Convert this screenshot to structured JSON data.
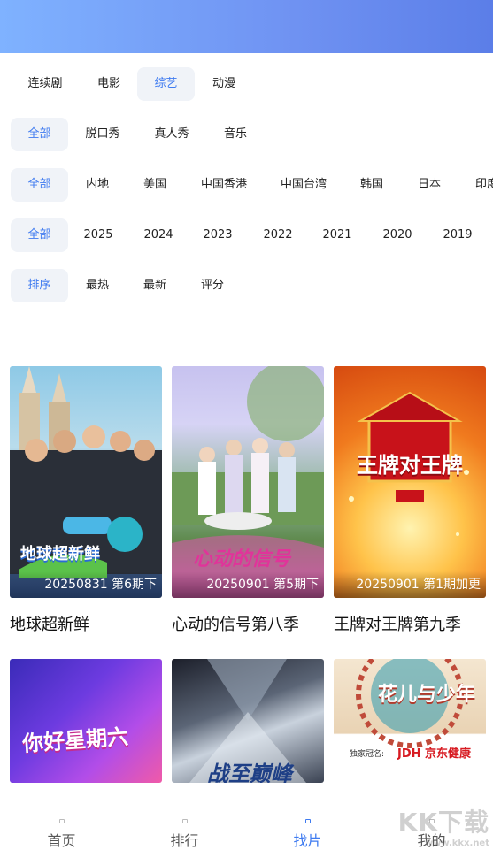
{
  "categories": [
    {
      "label": "连续剧",
      "active": false
    },
    {
      "label": "电影",
      "active": false
    },
    {
      "label": "综艺",
      "active": true
    },
    {
      "label": "动漫",
      "active": false
    }
  ],
  "filters": {
    "genre": [
      "全部",
      "脱口秀",
      "真人秀",
      "音乐"
    ],
    "region": [
      "全部",
      "内地",
      "美国",
      "中国香港",
      "中国台湾",
      "韩国",
      "日本",
      "印度"
    ],
    "year": [
      "全部",
      "2025",
      "2024",
      "2023",
      "2022",
      "2021",
      "2020",
      "2019"
    ],
    "sort": [
      "排序",
      "最热",
      "最新",
      "评分"
    ]
  },
  "shows": [
    {
      "title": "地球超新鲜",
      "episode": "20250831 第6期下",
      "poster_text": "地球超新鲜"
    },
    {
      "title": "心动的信号第八季",
      "episode": "20250901 第5期下",
      "poster_text": "心动的信号"
    },
    {
      "title": "王牌对王牌第九季",
      "episode": "20250901 第1期加更",
      "poster_text": "王牌对王牌"
    }
  ],
  "more_shows": [
    {
      "poster_text": "你好星期六"
    },
    {
      "poster_text": "战至巅峰"
    },
    {
      "poster_text": "花儿与少年",
      "sponsor": "JDH 京东健康",
      "sponsor_label": "独家冠名:"
    }
  ],
  "tabbar": [
    {
      "label": "首页",
      "active": false
    },
    {
      "label": "排行",
      "active": false
    },
    {
      "label": "找片",
      "active": true
    },
    {
      "label": "我的",
      "active": false
    }
  ],
  "watermark": {
    "text": "KK下载",
    "sub": "www.kkx.net"
  }
}
